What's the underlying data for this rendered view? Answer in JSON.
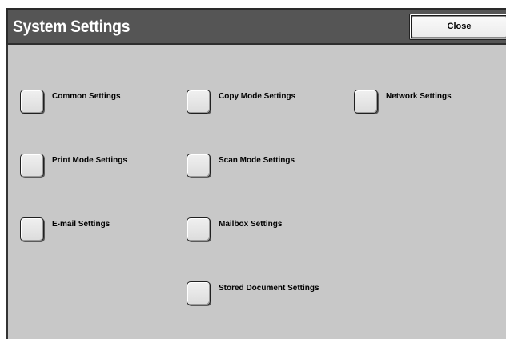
{
  "header": {
    "title": "System Settings",
    "close_label": "Close"
  },
  "options": {
    "common_settings": "Common Settings",
    "copy_mode_settings": "Copy Mode Settings",
    "network_settings": "Network Settings",
    "print_mode_settings": "Print Mode Settings",
    "scan_mode_settings": "Scan Mode Settings",
    "email_settings": "E-mail Settings",
    "mailbox_settings": "Mailbox Settings",
    "stored_document_settings": "Stored Document Settings"
  },
  "colors": {
    "title_bar": "#555555",
    "panel_background": "#c8c8c8",
    "button_face": "#eeeeee"
  }
}
